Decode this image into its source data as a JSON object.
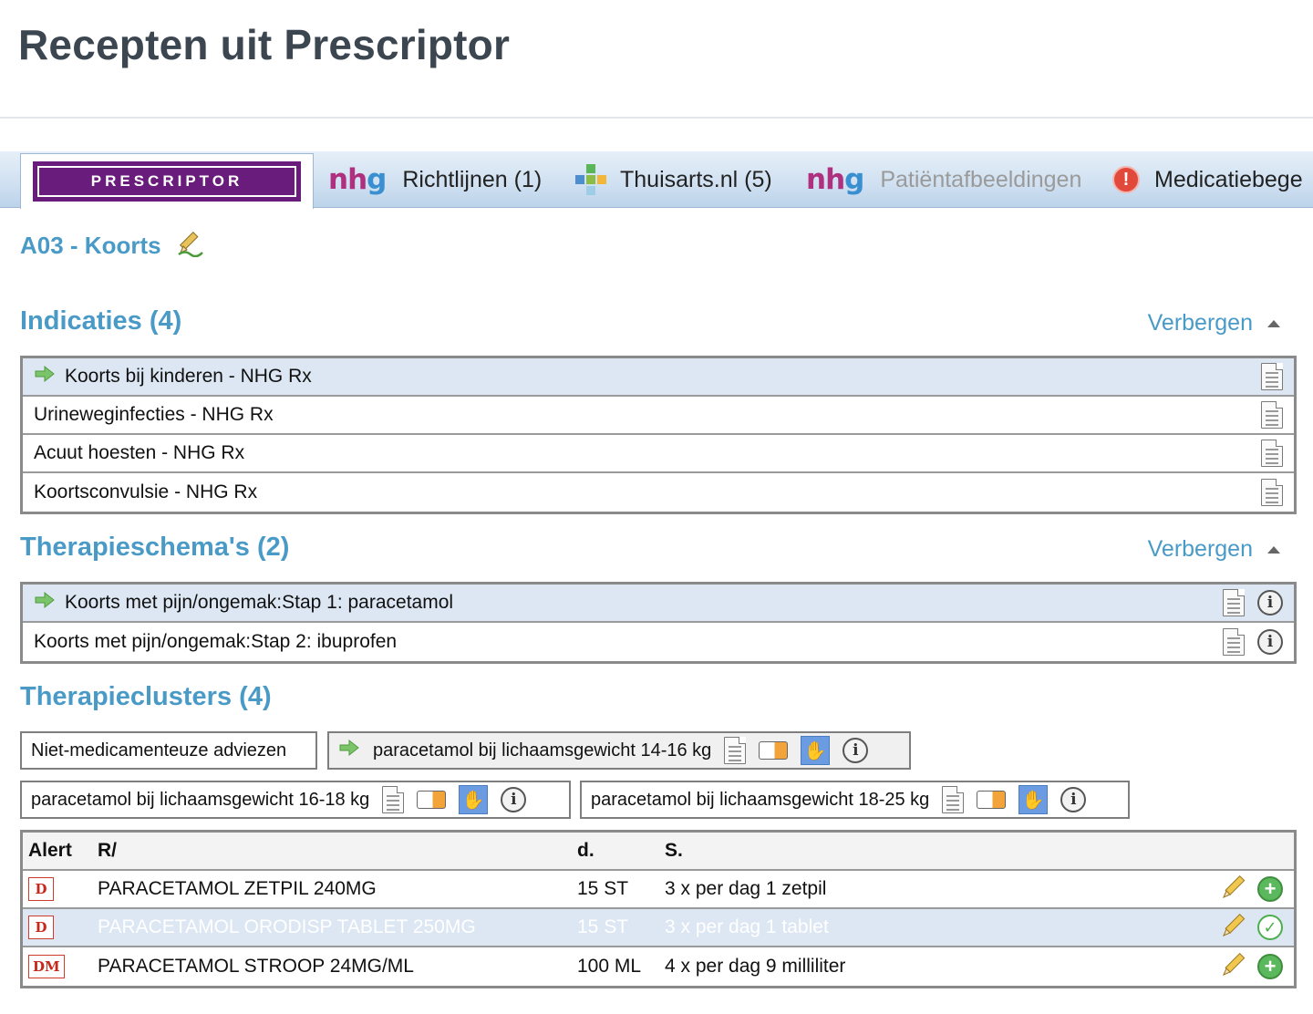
{
  "page_title": "Recepten uit Prescriptor",
  "tabs": {
    "prescriptor_logo": "PRESCRIPTOR",
    "nhg_logo_n": "nh",
    "nhg_logo_g": "g",
    "richtlijnen": "Richtlijnen (1)",
    "thuisarts": "Thuisarts.nl (5)",
    "patientafbeeldingen": "Patiëntafbeeldingen",
    "medicatie": "Medicatiebege",
    "alert_glyph": "!"
  },
  "episode": "A03 - Koorts",
  "indicaties": {
    "title": "Indicaties (4)",
    "toggle": "Verbergen",
    "items": [
      "Koorts bij kinderen - NHG Rx",
      "Urineweginfecties - NHG Rx",
      "Acuut hoesten - NHG Rx",
      "Koortsconvulsie - NHG Rx"
    ]
  },
  "therapieschemas": {
    "title": "Therapieschema's (2)",
    "toggle": "Verbergen",
    "items": [
      "Koorts met pijn/ongemak:Stap 1: paracetamol",
      "Koorts met pijn/ongemak:Stap 2: ibuprofen"
    ]
  },
  "therapieclusters": {
    "title": "Therapieclusters (4)",
    "items": [
      "Niet-medicamenteuze adviezen",
      "paracetamol bij lichaamsgewicht 14-16 kg",
      "paracetamol bij lichaamsgewicht 16-18 kg",
      "paracetamol bij lichaamsgewicht 18-25 kg"
    ]
  },
  "medications": {
    "headers": {
      "alert": "Alert",
      "r": "R/",
      "d": "d.",
      "s": "S."
    },
    "rows": [
      {
        "alert": "D",
        "r": "PARACETAMOL ZETPIL 240MG",
        "d": "15 ST",
        "s": "3 x per dag 1 zetpil"
      },
      {
        "alert": "D",
        "r": "PARACETAMOL ORODISP TABLET 250MG",
        "d": "15 ST",
        "s": "3 x per dag 1 tablet"
      },
      {
        "alert": "DM",
        "r": "PARACETAMOL STROOP 24MG/ML",
        "d": "100 ML",
        "s": "4 x per dag 9 milliliter"
      }
    ]
  },
  "icon_glyphs": {
    "info": "i",
    "plus": "+",
    "check": "✓",
    "hand": "✋"
  },
  "colors": {
    "accent": "#4a9ac7",
    "prescriptor_purple": "#6a1c7c",
    "selection": "#dde7f3"
  }
}
